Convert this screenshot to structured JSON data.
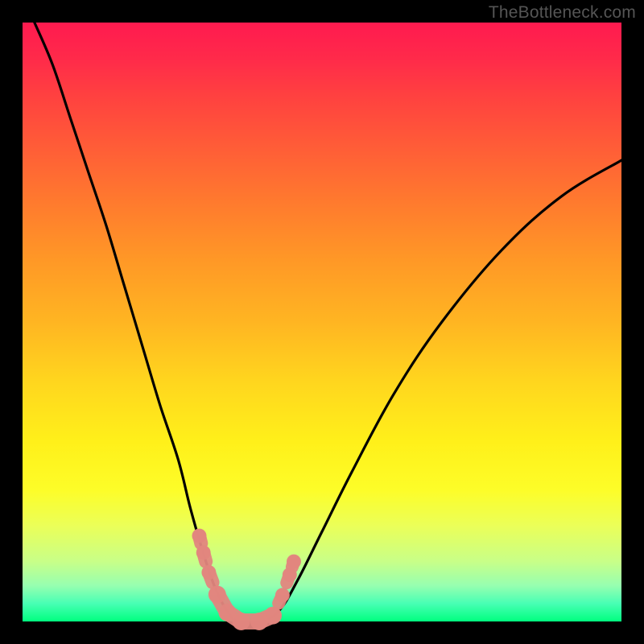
{
  "watermark": "TheBottleneck.com",
  "colors": {
    "pink": "#e2867e",
    "black": "#000000"
  },
  "chart_data": {
    "type": "line",
    "title": "",
    "xlabel": "",
    "ylabel": "",
    "xlim": [
      0,
      1
    ],
    "ylim": [
      0,
      1
    ],
    "curve": [
      {
        "x": 0.02,
        "y": 1.0
      },
      {
        "x": 0.05,
        "y": 0.93
      },
      {
        "x": 0.08,
        "y": 0.84
      },
      {
        "x": 0.11,
        "y": 0.75
      },
      {
        "x": 0.14,
        "y": 0.66
      },
      {
        "x": 0.17,
        "y": 0.56
      },
      {
        "x": 0.2,
        "y": 0.46
      },
      {
        "x": 0.23,
        "y": 0.36
      },
      {
        "x": 0.26,
        "y": 0.27
      },
      {
        "x": 0.28,
        "y": 0.19
      },
      {
        "x": 0.3,
        "y": 0.12
      },
      {
        "x": 0.32,
        "y": 0.06
      },
      {
        "x": 0.34,
        "y": 0.02
      },
      {
        "x": 0.36,
        "y": 0.0
      },
      {
        "x": 0.4,
        "y": 0.0
      },
      {
        "x": 0.43,
        "y": 0.02
      },
      {
        "x": 0.46,
        "y": 0.07
      },
      {
        "x": 0.5,
        "y": 0.15
      },
      {
        "x": 0.55,
        "y": 0.25
      },
      {
        "x": 0.62,
        "y": 0.38
      },
      {
        "x": 0.7,
        "y": 0.5
      },
      {
        "x": 0.8,
        "y": 0.62
      },
      {
        "x": 0.9,
        "y": 0.71
      },
      {
        "x": 1.0,
        "y": 0.77
      }
    ],
    "highlight_range_x": [
      0.29,
      0.45
    ],
    "highlight_points": [
      {
        "x": 0.295,
        "y": 0.143
      },
      {
        "x": 0.302,
        "y": 0.115
      },
      {
        "x": 0.311,
        "y": 0.082
      },
      {
        "x": 0.325,
        "y": 0.045
      },
      {
        "x": 0.342,
        "y": 0.015
      },
      {
        "x": 0.365,
        "y": 0.0
      },
      {
        "x": 0.395,
        "y": 0.0
      },
      {
        "x": 0.418,
        "y": 0.01
      },
      {
        "x": 0.434,
        "y": 0.044
      },
      {
        "x": 0.446,
        "y": 0.078
      },
      {
        "x": 0.453,
        "y": 0.1
      }
    ]
  }
}
